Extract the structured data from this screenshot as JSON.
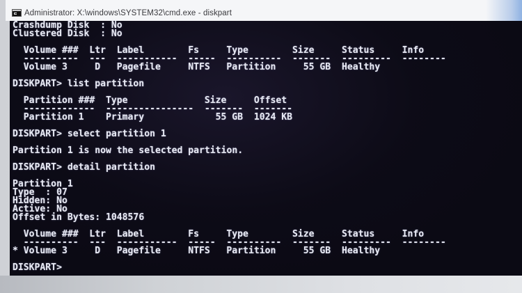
{
  "window": {
    "title": "Administrator: X:\\windows\\SYSTEM32\\cmd.exe - diskpart",
    "icon": "cmd-icon"
  },
  "console": {
    "prompt": "DISKPART>",
    "delimiter": ":",
    "disk_details": {
      "attributes": [
        {
          "label": "Crashdump Disk",
          "value": "No"
        },
        {
          "label": "Clustered Disk",
          "value": "No"
        }
      ],
      "volumes": {
        "headers": [
          "Volume ###",
          "Ltr",
          "Label",
          "Fs",
          "Type",
          "Size",
          "Status",
          "Info"
        ],
        "separators": [
          "----------",
          "---",
          "-----------",
          "-----",
          "----------",
          "-------",
          "---------",
          "--------"
        ],
        "rows": [
          {
            "marker": "",
            "cells": [
              "Volume 3",
              "D",
              "Pagefile",
              "NTFS",
              "Partition",
              "55 GB",
              "Healthy",
              ""
            ]
          }
        ]
      }
    },
    "list_partition": {
      "command": "list partition",
      "table": {
        "headers": [
          "Partition ###",
          "Type",
          "Size",
          "Offset"
        ],
        "separators": [
          "-------------",
          "----------------",
          "-------",
          "-------"
        ],
        "rows": [
          {
            "marker": "",
            "cells": [
              "Partition 1",
              "Primary",
              "55 GB",
              "1024 KB"
            ]
          }
        ]
      }
    },
    "select_partition": {
      "command": "select partition 1",
      "message": "Partition 1 is now the selected partition."
    },
    "detail_partition": {
      "command": "detail partition",
      "heading": "Partition 1",
      "attributes": [
        {
          "label": "Type",
          "value": "07"
        },
        {
          "label": "Hidden",
          "value": "No"
        },
        {
          "label": "Active",
          "value": "No"
        },
        {
          "label": "Offset in Bytes",
          "value": "1048576"
        }
      ],
      "volumes": {
        "headers": [
          "Volume ###",
          "Ltr",
          "Label",
          "Fs",
          "Type",
          "Size",
          "Status",
          "Info"
        ],
        "separators": [
          "----------",
          "---",
          "-----------",
          "-----",
          "----------",
          "-------",
          "---------",
          "--------"
        ],
        "rows": [
          {
            "marker": "*",
            "cells": [
              "Volume 3",
              "D",
              "Pagefile",
              "NTFS",
              "Partition",
              "55 GB",
              "Healthy",
              ""
            ]
          }
        ]
      }
    }
  },
  "colors": {
    "console_background": "#0b0a14",
    "console_text": "#e6e8f2",
    "title_bar": "#f5f6f8",
    "title_text": "#3a3a3e",
    "screen_surround": "#d9dbe0"
  }
}
